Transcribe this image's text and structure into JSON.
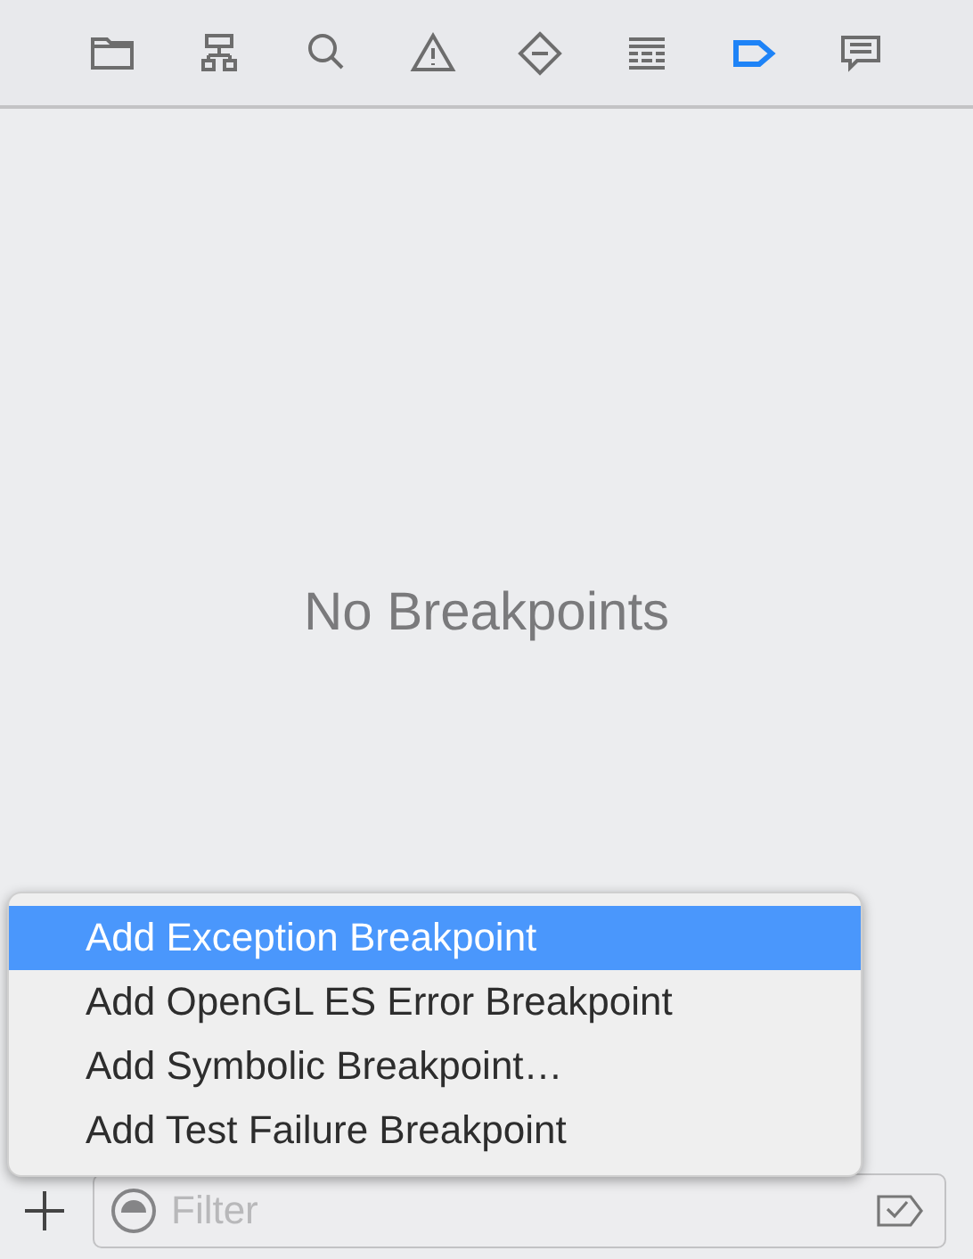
{
  "navigator_tabs": [
    {
      "selected": false
    },
    {
      "selected": false
    },
    {
      "selected": false
    },
    {
      "selected": false
    },
    {
      "selected": false
    },
    {
      "selected": false
    },
    {
      "selected": true
    },
    {
      "selected": false
    }
  ],
  "empty_message": "No Breakpoints",
  "add_menu": {
    "items": [
      {
        "label": "Add Exception Breakpoint",
        "selected": true
      },
      {
        "label": "Add OpenGL ES Error Breakpoint",
        "selected": false
      },
      {
        "label": "Add Symbolic Breakpoint…",
        "selected": false
      },
      {
        "label": "Add Test Failure Breakpoint",
        "selected": false
      }
    ]
  },
  "filter": {
    "placeholder": "Filter"
  }
}
